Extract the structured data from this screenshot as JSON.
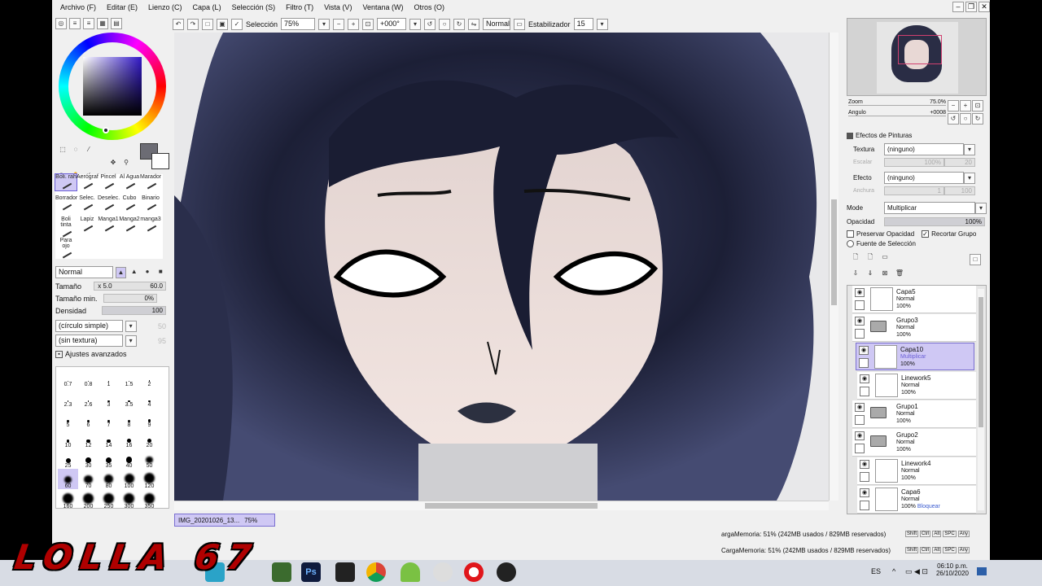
{
  "menu": [
    "Archivo (F)",
    "Editar (E)",
    "Lienzo (C)",
    "Capa (L)",
    "Selección (S)",
    "Filtro (T)",
    "Vista (V)",
    "Ventana (W)",
    "Otros (O)"
  ],
  "toolbar": {
    "selection_label": "Selección",
    "zoom": "75%",
    "rotation": "+000°",
    "mode": "Normal",
    "stabilizer_label": "Estabilizador",
    "stabilizer_value": "15"
  },
  "brushes": [
    "Boli. rah",
    "Aerógraf",
    "Pincel",
    "Al Agua",
    "Marador",
    "Borrador",
    "Selec.",
    "Deselec.",
    "Cubo",
    "Binario",
    "Boli tinta",
    "Lapiz",
    "Manga1",
    "Manga2",
    "manga3",
    "Para ojo"
  ],
  "brush_settings": {
    "blend_mode": "Normal",
    "size_label": "Tamaño",
    "size_mult": "x 5.0",
    "size_value": "60.0",
    "min_size_label": "Tamaño min.",
    "min_size_value": "0%",
    "density_label": "Densidad",
    "density_value": "100",
    "shape": "(círculo simple)",
    "shape_value": "50",
    "texture": "(sin textura)",
    "texture_value": "95",
    "advanced": "Ajustes avanzados"
  },
  "brush_sizes": [
    "0.7",
    "0.8",
    "1",
    "1.5",
    "2",
    "2.3",
    "2.6",
    "3",
    "3.5",
    "4",
    "5",
    "6",
    "7",
    "8",
    "9",
    "10",
    "12",
    "14",
    "16",
    "20",
    "25",
    "30",
    "35",
    "40",
    "50",
    "60",
    "70",
    "80",
    "100",
    "120",
    "160",
    "200",
    "250",
    "300",
    "350"
  ],
  "document_tab": {
    "name": "IMG_20201026_13...",
    "zoom": "75%"
  },
  "navigator": {
    "zoom_label": "Zoom",
    "zoom_value": "75.0%",
    "angle_label": "Angulo",
    "angle_value": "+0008"
  },
  "effects": {
    "title": "Efectos de Pinturas",
    "texture_label": "Textura",
    "texture_value": "(ninguno)",
    "scale_label": "Escalar",
    "scale_value": "100%",
    "scale_num": "20",
    "effect_label": "Efecto",
    "effect_value": "(ninguno)",
    "width_label": "Anchura",
    "width_value": "1",
    "width_num": "100"
  },
  "layer_props": {
    "mode_label": "Mode",
    "mode_value": "Multiplicar",
    "opacity_label": "Opacidad",
    "opacity_value": "100%",
    "preserve_label": "Preservar Opacidad",
    "clip_label": "Recortar Grupo",
    "source_label": "Fuente de Selección"
  },
  "layers": [
    {
      "name": "Capa5",
      "mode": "Normal",
      "opacity": "100%",
      "type": "layer"
    },
    {
      "name": "Grupo3",
      "mode": "Normal",
      "opacity": "100%",
      "type": "folder"
    },
    {
      "name": "Capa10",
      "mode": "Multiplicar",
      "opacity": "100%",
      "type": "layer"
    },
    {
      "name": "Linework5",
      "mode": "Normal",
      "opacity": "100%",
      "type": "layer"
    },
    {
      "name": "Grupo1",
      "mode": "Normal",
      "opacity": "100%",
      "type": "folder"
    },
    {
      "name": "Grupo2",
      "mode": "Normal",
      "opacity": "100%",
      "type": "folder"
    },
    {
      "name": "Linework4",
      "mode": "Normal",
      "opacity": "100%",
      "type": "layer"
    },
    {
      "name": "Capa6",
      "mode": "Normal",
      "opacity": "100%",
      "lock": "Bloquear",
      "type": "layer"
    }
  ],
  "status": {
    "memory": "argaMemoria: 51% (242MB usados / 829MB reservados)",
    "memory2": "CargaMemoria: 51% (242MB usados / 829MB reservados)",
    "keys": [
      "Shift",
      "Ctrl",
      "Alt",
      "SPC",
      "Any"
    ]
  },
  "taskbar": {
    "lang": "ES",
    "time": "06:10 p.m.",
    "date": "26/10/2020"
  },
  "watermark": "LOLLA 67",
  "colors": {
    "accent": "#6b5fd6",
    "selected_layer": "#cfc8f4",
    "watermark": "#b00000"
  }
}
